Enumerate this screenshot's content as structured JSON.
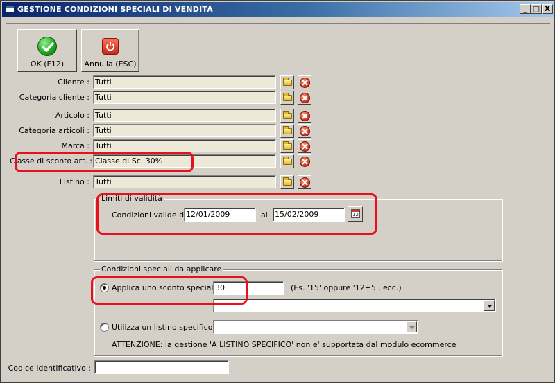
{
  "window": {
    "title": "GESTIONE CONDIZIONI SPECIALI DI VENDITA",
    "controls": [
      "_",
      "□",
      "X"
    ]
  },
  "toolbar": {
    "ok_label": "OK (F12)",
    "cancel_label": "Annulla (ESC)"
  },
  "filters": {
    "cliente": {
      "label": "Cliente :",
      "value": "Tutti"
    },
    "categoria_cliente": {
      "label": "Categoria cliente :",
      "value": "Tutti"
    },
    "articolo": {
      "label": "Articolo :",
      "value": "Tutti"
    },
    "categoria_articoli": {
      "label": "Categoria articoli :",
      "value": "Tutti"
    },
    "marca": {
      "label": "Marca :",
      "value": "Tutti"
    },
    "classe_sconto": {
      "label": "Classe di sconto art. :",
      "value": "Classe di Sc. 30%"
    },
    "listino": {
      "label": "Listino :",
      "value": "Tutti"
    }
  },
  "validity": {
    "group_title": "Limiti di validità",
    "from_label": "Condizioni valide dal",
    "from_value": "12/01/2009",
    "to_label": "al",
    "to_value": "15/02/2009",
    "calendar_glyph": "12"
  },
  "conditions": {
    "group_title": "Condizioni speciali da applicare",
    "option_discount": {
      "label": "Applica uno sconto speciale",
      "value": "30",
      "hint": "(Es. '15' oppure '12+5', ecc.)",
      "selected": true
    },
    "option_pricelist": {
      "label": "Utilizza un listino specifico",
      "value": "",
      "selected": false
    },
    "warning": "ATTENZIONE: la gestione 'A LISTINO SPECIFICO' non e' supportata dal modulo ecommerce"
  },
  "identifier": {
    "label": "Codice identificativo :",
    "value": ""
  },
  "colors": {
    "highlight": "#e8101a",
    "titlebar_start": "#0a246a",
    "titlebar_end": "#a6caf0",
    "face": "#d4d0c8"
  }
}
